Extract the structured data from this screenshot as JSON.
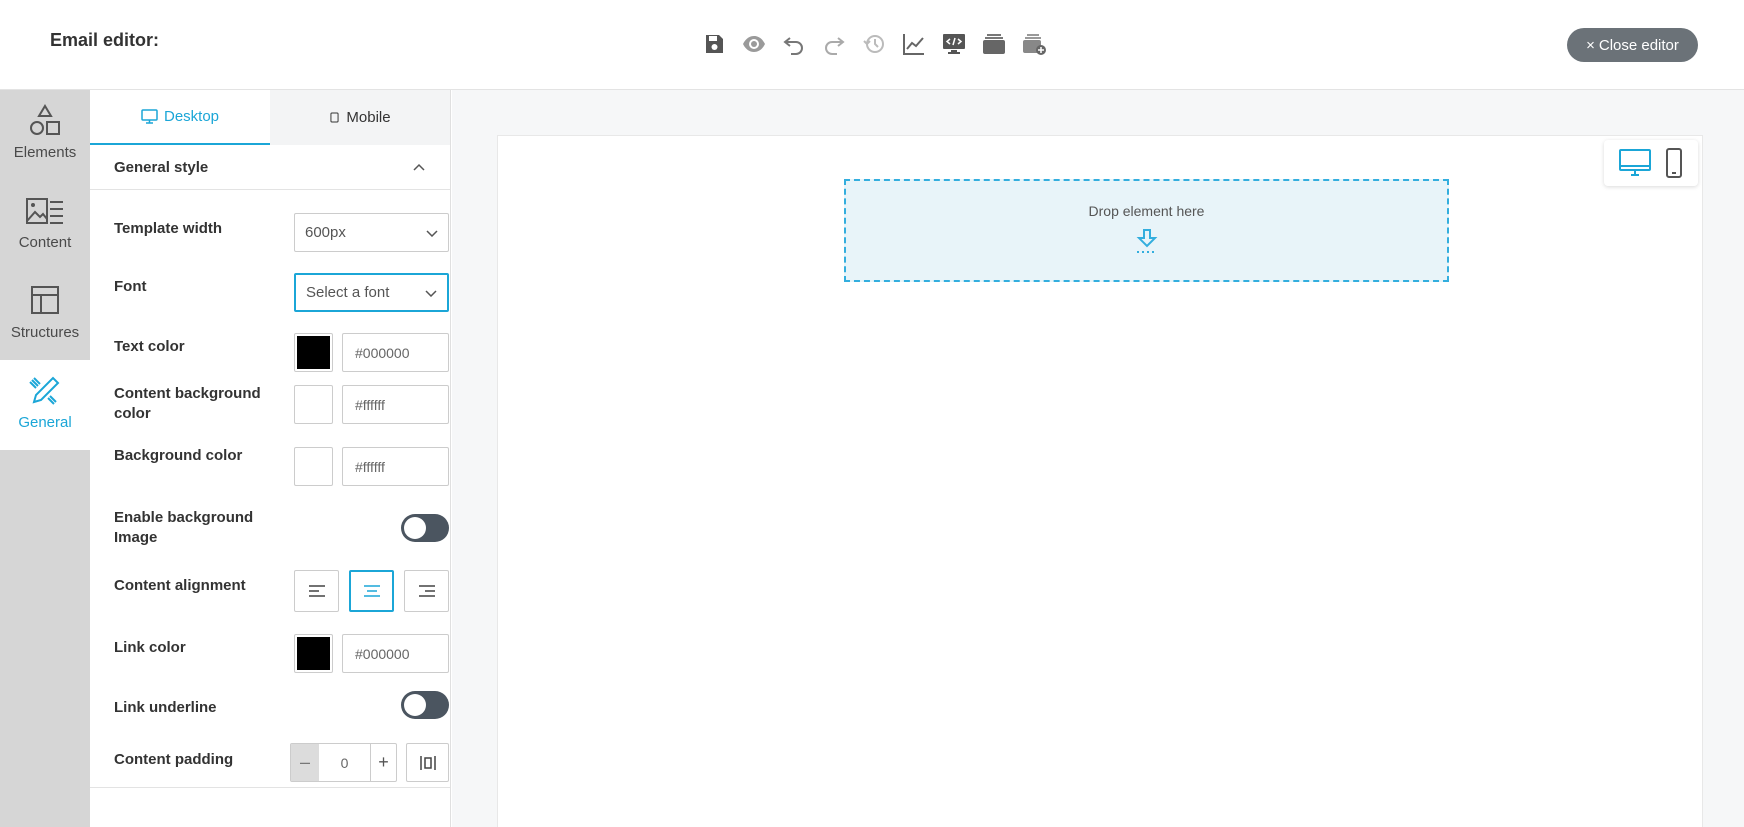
{
  "header": {
    "title": "Email editor:",
    "toolbar": [
      {
        "name": "save-icon"
      },
      {
        "name": "preview-eye-icon"
      },
      {
        "name": "undo-icon"
      },
      {
        "name": "redo-icon"
      },
      {
        "name": "history-icon"
      },
      {
        "name": "analytics-chart-icon"
      },
      {
        "name": "code-view-icon"
      },
      {
        "name": "templates-icon"
      },
      {
        "name": "add-template-icon"
      }
    ],
    "close_label": "Close editor",
    "close_icon": "×"
  },
  "rail": {
    "items": [
      {
        "label": "Elements",
        "icon": "shapes-icon"
      },
      {
        "label": "Content",
        "icon": "image-text-icon"
      },
      {
        "label": "Structures",
        "icon": "layout-icon"
      },
      {
        "label": "General",
        "icon": "pencil-ruler-icon",
        "active": true
      }
    ]
  },
  "panel": {
    "tabs": [
      {
        "label": "Desktop",
        "active": true
      },
      {
        "label": "Mobile",
        "active": false
      }
    ],
    "section_title": "General style",
    "template_width": {
      "label": "Template width",
      "value": "600px"
    },
    "font": {
      "label": "Font",
      "placeholder": "Select a font"
    },
    "text_color": {
      "label": "Text color",
      "value": "#000000",
      "swatch": "#000000"
    },
    "content_bg_color": {
      "label": "Content background color",
      "value": "#ffffff",
      "swatch": "#ffffff"
    },
    "bg_color": {
      "label": "Background color",
      "value": "#ffffff",
      "swatch": "#ffffff"
    },
    "bg_image": {
      "label": "Enable background Image",
      "enabled": false
    },
    "alignment": {
      "label": "Content alignment",
      "options": [
        "left",
        "center",
        "right"
      ],
      "selected": "center"
    },
    "link_color": {
      "label": "Link color",
      "value": "#000000",
      "swatch": "#000000"
    },
    "link_underline": {
      "label": "Link underline",
      "enabled": false
    },
    "content_padding": {
      "label": "Content padding",
      "value": "0",
      "minus": "–",
      "plus": "+"
    }
  },
  "canvas": {
    "drop_text": "Drop element here",
    "view_modes": [
      "desktop",
      "mobile"
    ],
    "active_view": "desktop"
  },
  "colors": {
    "accent": "#1ba6d7",
    "rail_bg": "#d6d6d6",
    "close_btn": "#6b7278",
    "drop_zone_bg": "#e8f4f9"
  }
}
